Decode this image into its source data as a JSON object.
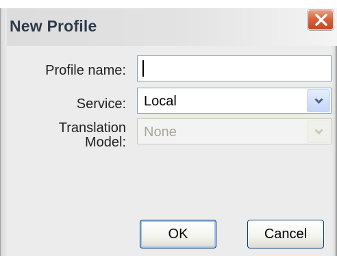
{
  "window": {
    "title": "New Profile",
    "close_icon": "close-x-icon"
  },
  "form": {
    "profile_name_label": "Profile name:",
    "profile_name_value": "",
    "service_label": "Service:",
    "service_value": "Local",
    "translation_model_label_line1": "Translation",
    "translation_model_label_line2": "Model:",
    "translation_model_value": "None",
    "translation_model_enabled": false,
    "dropdown_icon": "chevron-down-icon"
  },
  "buttons": {
    "ok_label": "OK",
    "cancel_label": "Cancel"
  },
  "colors": {
    "close_button": "#d8643f",
    "field_border": "#7f9db9",
    "disabled_text": "#a8a599",
    "button_border": "#003c74"
  }
}
